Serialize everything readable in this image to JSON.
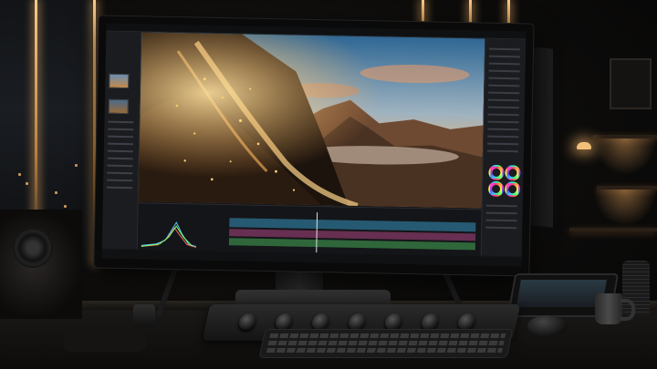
{
  "scene": {
    "description_visible_text": "",
    "accent_colors": {
      "warm_light": "#f7c98a",
      "sky": "#3b6f9a",
      "mountain": "#5b3f2a",
      "particles": "#ffc468"
    }
  },
  "monitor": {
    "app_window": {
      "menu": [
        "",
        "",
        "",
        "",
        "",
        ""
      ],
      "viewer_image": "mountain-landscape-with-golden-particles",
      "color_wheels": 4
    }
  },
  "icons": {
    "knobs": 7
  }
}
